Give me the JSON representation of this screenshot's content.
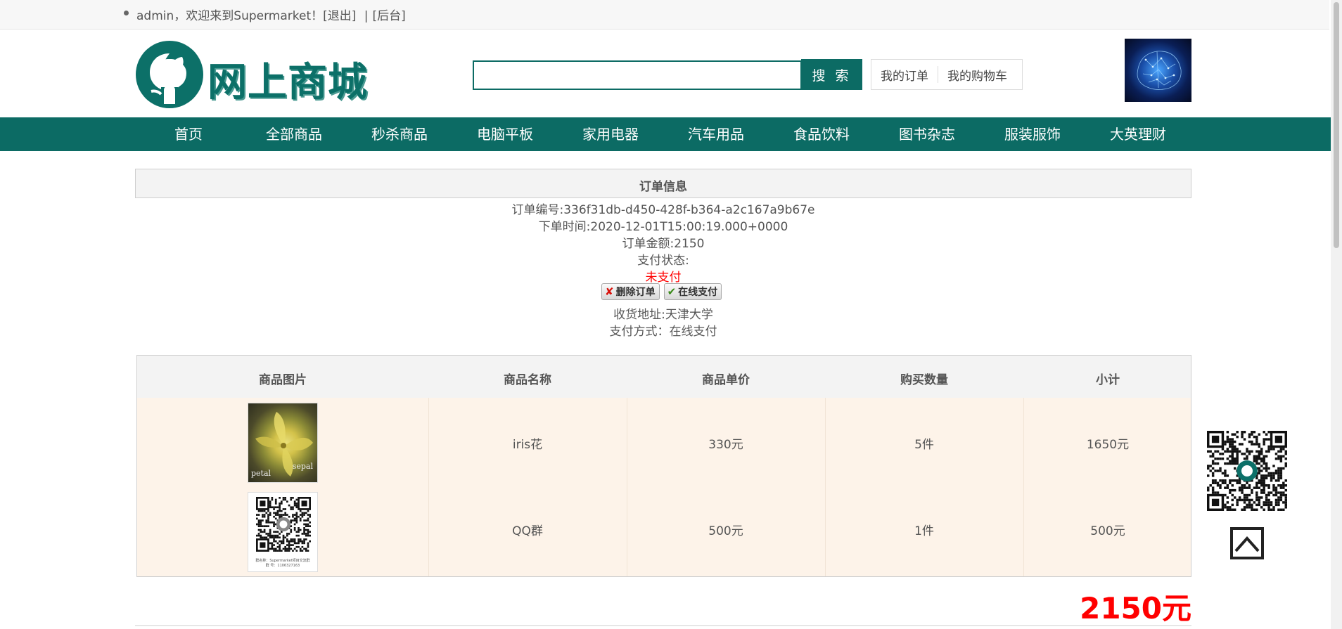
{
  "topbar": {
    "user": "admin",
    "welcome": "，欢迎来到Supermarket！",
    "logout": "[退出]",
    "separator": "|",
    "admin": "[后台]"
  },
  "header": {
    "logo_text": "网上商城",
    "search": {
      "value": "",
      "placeholder": "",
      "button": "搜 索"
    },
    "links": [
      "我的订单",
      "我的购物车"
    ]
  },
  "nav": {
    "items": [
      "首页",
      "全部商品",
      "秒杀商品",
      "电脑平板",
      "家用电器",
      "汽车用品",
      "食品饮料",
      "图书杂志",
      "服装服饰",
      "大英理财"
    ]
  },
  "order": {
    "title": "订单信息",
    "number": "订单编号:336f31db-d450-428f-b364-a2c167a9b67e",
    "time": "下单时间:2020-12-01T15:00:19.000+0000",
    "amount": "订单金额:2150",
    "pay_status_label": "支付状态:",
    "pay_status": "未支付",
    "delete_btn": "删除订单",
    "pay_btn": "在线支付",
    "address": "收货地址:天津大学",
    "pay_method": "支付方式：在线支付"
  },
  "table": {
    "headers": [
      "商品图片",
      "商品名称",
      "商品单价",
      "购买数量",
      "小计"
    ],
    "rows": [
      {
        "name": "iris花",
        "price": "330元",
        "qty": "5件",
        "subtotal": "1650元",
        "img_labels": [
          "petal",
          "sepal"
        ]
      },
      {
        "name": "QQ群",
        "price": "500元",
        "qty": "1件",
        "subtotal": "500元",
        "img_caption": "群名称：Supermarket项目交流群",
        "img_caption2": "群 号：1106327163"
      }
    ]
  },
  "total": "2150元",
  "colors": {
    "brand": "#0c6b64",
    "alert": "#ff0000",
    "row_bg": "#fdf3e9"
  }
}
